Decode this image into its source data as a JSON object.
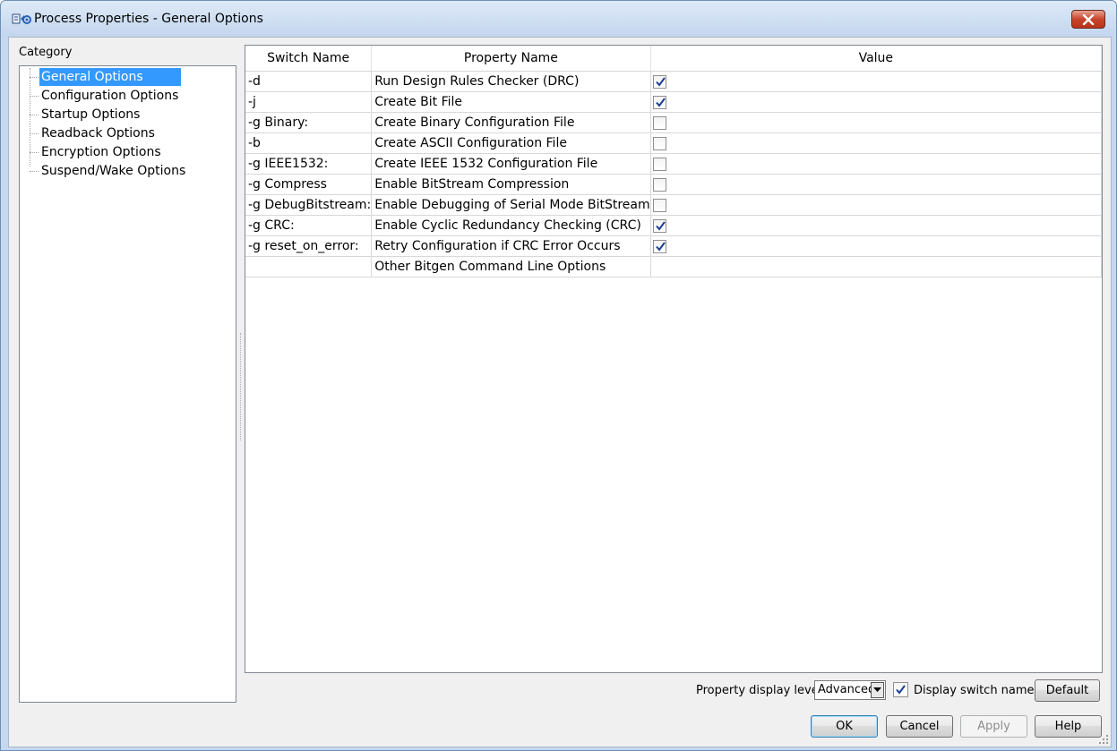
{
  "window": {
    "title": "Process Properties - General Options",
    "close_glyph": "✕"
  },
  "category": {
    "label": "Category",
    "items": [
      {
        "label": "General Options",
        "selected": true
      },
      {
        "label": "Configuration Options",
        "selected": false
      },
      {
        "label": "Startup Options",
        "selected": false
      },
      {
        "label": "Readback Options",
        "selected": false
      },
      {
        "label": "Encryption Options",
        "selected": false
      },
      {
        "label": "Suspend/Wake Options",
        "selected": false
      }
    ]
  },
  "grid": {
    "columns": [
      "Switch Name",
      "Property Name",
      "Value"
    ],
    "rows": [
      {
        "switch": "-d",
        "property": "Run Design Rules Checker (DRC)",
        "value": "checkbox",
        "checked": true
      },
      {
        "switch": "-j",
        "property": "Create Bit File",
        "value": "checkbox",
        "checked": true
      },
      {
        "switch": "-g Binary:",
        "property": "Create Binary Configuration File",
        "value": "checkbox",
        "checked": false
      },
      {
        "switch": "-b",
        "property": "Create ASCII Configuration File",
        "value": "checkbox",
        "checked": false
      },
      {
        "switch": "-g IEEE1532:",
        "property": "Create IEEE 1532 Configuration File",
        "value": "checkbox",
        "checked": false
      },
      {
        "switch": "-g Compress",
        "property": "Enable BitStream Compression",
        "value": "checkbox",
        "checked": false
      },
      {
        "switch": "-g DebugBitstream:",
        "property": "Enable Debugging of Serial Mode BitStream",
        "value": "checkbox",
        "checked": false
      },
      {
        "switch": "-g CRC:",
        "property": "Enable Cyclic Redundancy Checking (CRC)",
        "value": "checkbox",
        "checked": true
      },
      {
        "switch": "-g reset_on_error:",
        "property": "Retry Configuration if CRC Error Occurs",
        "value": "checkbox",
        "checked": true
      },
      {
        "switch": "",
        "property": "Other Bitgen Command Line Options",
        "value": "text",
        "text": ""
      }
    ]
  },
  "footer": {
    "display_level_label": "Property display level:",
    "display_level_value": "Advanced",
    "display_switch_names_label": "Display switch names",
    "display_switch_names_checked": true,
    "default_label": "Default",
    "ok_label": "OK",
    "cancel_label": "Cancel",
    "apply_label": "Apply",
    "help_label": "Help"
  },
  "colors": {
    "selection": "#3399ff",
    "check": "#1b3f91"
  }
}
